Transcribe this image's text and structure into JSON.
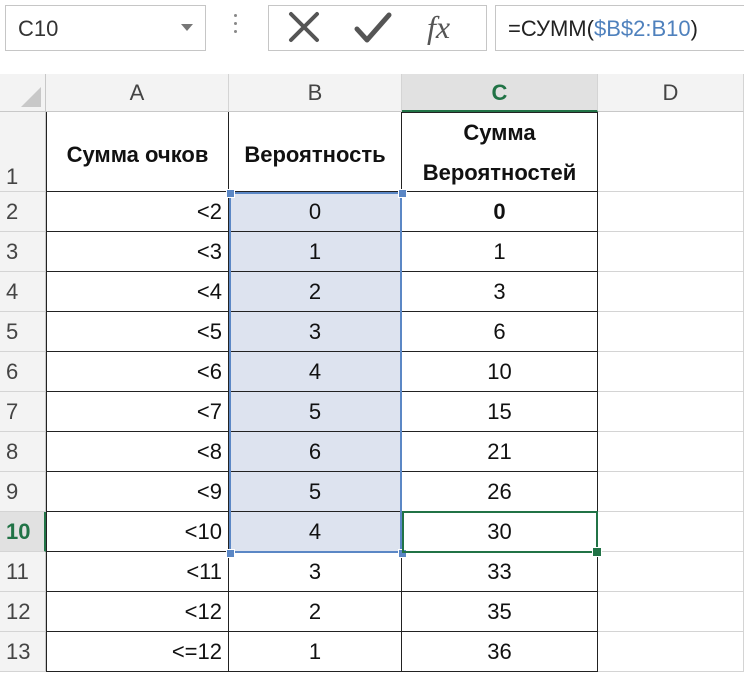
{
  "name_box": {
    "value": "C10"
  },
  "formula_bar": {
    "fx_label": "fx",
    "formula_prefix": "=СУММ(",
    "formula_ref": "$B$2:B10",
    "formula_suffix": ")"
  },
  "columns": [
    "A",
    "B",
    "C",
    "D"
  ],
  "active_column": "C",
  "active_row": "10",
  "header_row": {
    "row": "1",
    "a": "Сумма очков",
    "b": "Вероятность",
    "c_line1": "Сумма",
    "c_line2": "Вероятностей"
  },
  "rows": [
    {
      "row": "2",
      "a": "<2",
      "b": "0",
      "c": "0"
    },
    {
      "row": "3",
      "a": "<3",
      "b": "1",
      "c": "1"
    },
    {
      "row": "4",
      "a": "<4",
      "b": "2",
      "c": "3"
    },
    {
      "row": "5",
      "a": "<5",
      "b": "3",
      "c": "6"
    },
    {
      "row": "6",
      "a": "<6",
      "b": "4",
      "c": "10"
    },
    {
      "row": "7",
      "a": "<7",
      "b": "5",
      "c": "15"
    },
    {
      "row": "8",
      "a": "<8",
      "b": "6",
      "c": "21"
    },
    {
      "row": "9",
      "a": "<9",
      "b": "5",
      "c": "26"
    },
    {
      "row": "10",
      "a": "<10",
      "b": "4",
      "c": "30"
    },
    {
      "row": "11",
      "a": "<11",
      "b": "3",
      "c": "33"
    },
    {
      "row": "12",
      "a": "<12",
      "b": "2",
      "c": "35"
    },
    {
      "row": "13",
      "a": "<=12",
      "b": "1",
      "c": "36"
    }
  ],
  "colors": {
    "selection": "#5b87c5",
    "selection_fill": "#dde3ef",
    "active_cell": "#217346",
    "formula_ref": "#4f81bd"
  }
}
